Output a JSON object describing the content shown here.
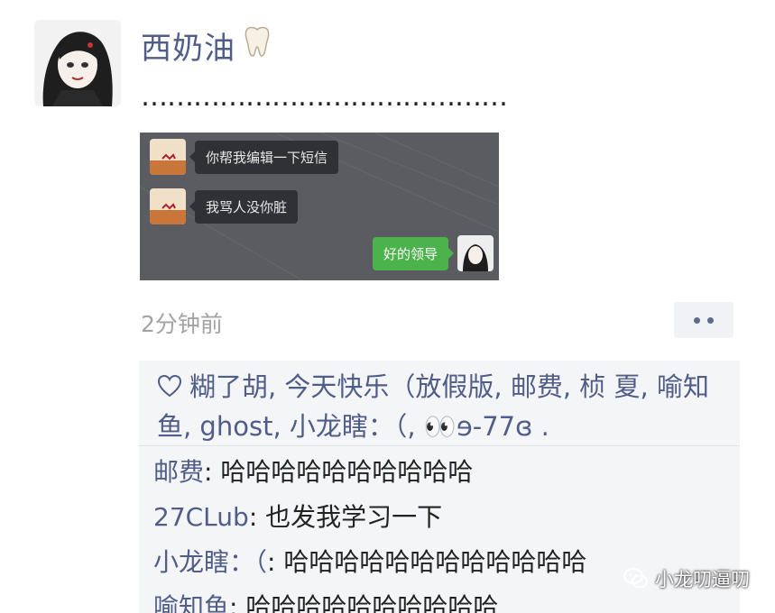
{
  "post": {
    "nickname": "西奶油",
    "nickname_icon": "tooth-emoji",
    "text": "……………………………………",
    "timestamp": "2分钟前"
  },
  "screenshot_chat": {
    "messages": [
      {
        "side": "left",
        "text": "你帮我编辑一下短信"
      },
      {
        "side": "left",
        "text": "我骂人没你脏"
      },
      {
        "side": "right",
        "text": "好的领导"
      }
    ]
  },
  "likes": {
    "icon": "heart-icon",
    "text": "糊了胡, 今天快乐（放假版, 邮费, 桢  夏, 喻知鱼, ghost, 小龙瞎：（, 👀ɘ-77ɞ ."
  },
  "comments": [
    {
      "author": "邮费",
      "text": ": 哈哈哈哈哈哈哈哈哈哈"
    },
    {
      "author": "27CLub",
      "text": ": 也发我学习一下"
    },
    {
      "author": "小龙瞎：（",
      "text": ": 哈哈哈哈哈哈哈哈哈哈哈哈"
    },
    {
      "author": "喻知鱼",
      "text": ": 哈哈哈哈哈哈哈哈哈哈"
    }
  ],
  "watermark": {
    "text": "小龙叨逼叨",
    "icon": "wechat-icon"
  },
  "colors": {
    "name_blue": "#4f5d88",
    "feedback_bg": "#f4f5f7",
    "chat_green": "#4cb24c",
    "chat_dark_bg": "#5a5c61"
  }
}
